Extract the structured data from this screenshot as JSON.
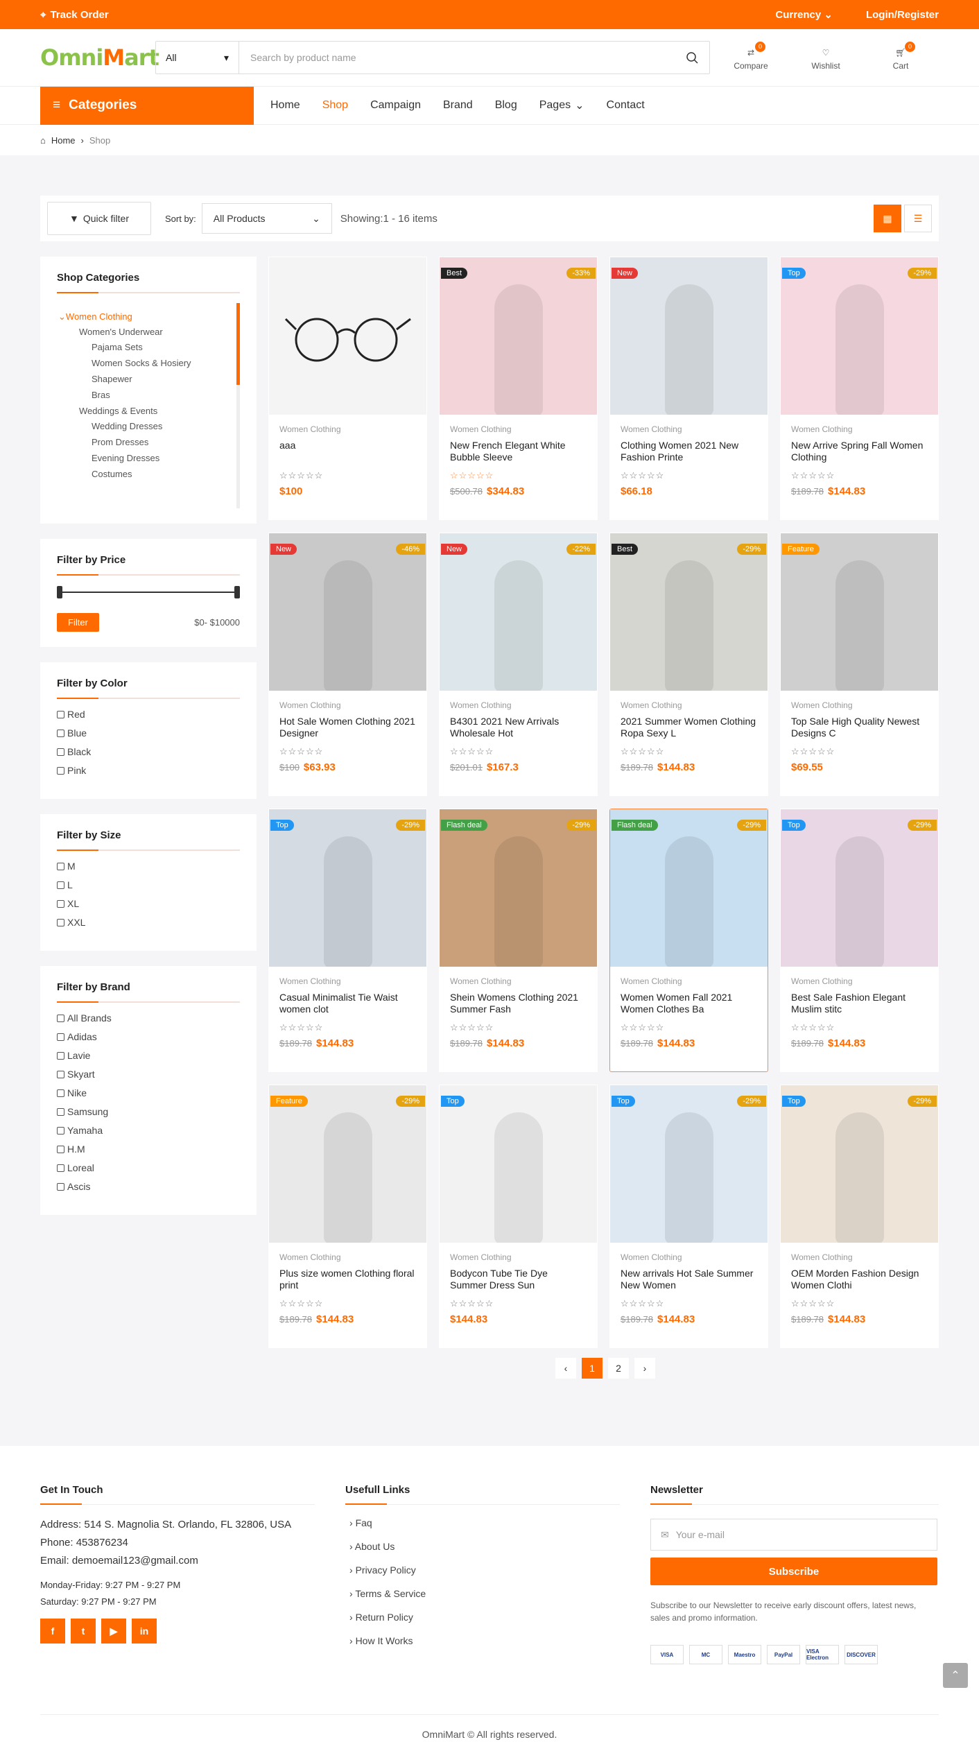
{
  "topbar": {
    "track": "Track Order",
    "currency": "Currency",
    "login": "Login/Register",
    "bg": "#ff6a00"
  },
  "header": {
    "logo_a": "Omni",
    "logo_b": "M",
    "logo_c": "art",
    "category": "All",
    "search_placeholder": "Search by product name",
    "compare": "Compare",
    "compare_count": "0",
    "wishlist": "Wishlist",
    "cart": "Cart",
    "cart_count": "0"
  },
  "nav": {
    "categories": "Categories",
    "items": [
      "Home",
      "Shop",
      "Campaign",
      "Brand",
      "Blog",
      "Pages",
      "Contact"
    ]
  },
  "breadcrumb": {
    "home": "Home",
    "current": "Shop"
  },
  "toolbar": {
    "quick_filter": "Quick filter",
    "sort_label": "Sort by:",
    "sort_value": "All Products",
    "showing": "Showing:1 - 16 items"
  },
  "sidebar": {
    "categories_title": "Shop Categories",
    "tree": [
      "Women Clothing",
      "Women's Underwear",
      "Pajama Sets",
      "Women Socks & Hosiery",
      "Shapewer",
      "Bras",
      "Weddings & Events",
      "Wedding Dresses",
      "Prom Dresses",
      "Evening Dresses",
      "Costumes"
    ],
    "price_title": "Filter by Price",
    "filter_btn": "Filter",
    "price_range": "$0- $10000",
    "color_title": "Filter by Color",
    "colors": [
      "Red",
      "Blue",
      "Black",
      "Pink"
    ],
    "size_title": "Filter by Size",
    "sizes": [
      "M",
      "L",
      "XL",
      "XXL"
    ],
    "brand_title": "Filter by Brand",
    "brands": [
      "All Brands",
      "Adidas",
      "Lavie",
      "Skyart",
      "Nike",
      "Samsung",
      "Yamaha",
      "H.M",
      "Loreal",
      "Ascis"
    ]
  },
  "products": [
    {
      "label": "",
      "discount": "",
      "cat": "Women Clothing",
      "name": "aaa",
      "old": "",
      "price": "$100"
    },
    {
      "label": "Best",
      "discount": "-33%",
      "cat": "Women Clothing",
      "name": "New French Elegant White Bubble Sleeve",
      "old": "$500.78",
      "price": "$344.83"
    },
    {
      "label": "New",
      "discount": "",
      "cat": "Women Clothing",
      "name": "Clothing Women 2021 New Fashion Printe",
      "old": "",
      "price": "$66.18"
    },
    {
      "label": "Top",
      "discount": "-29%",
      "cat": "Women Clothing",
      "name": "New Arrive Spring Fall Women Clothing",
      "old": "$189.78",
      "price": "$144.83"
    },
    {
      "label": "New",
      "discount": "-46%",
      "cat": "Women Clothing",
      "name": "Hot Sale Women Clothing 2021 Designer",
      "old": "$100",
      "price": "$63.93"
    },
    {
      "label": "New",
      "discount": "-22%",
      "cat": "Women Clothing",
      "name": "B4301 2021 New Arrivals Wholesale Hot",
      "old": "$201.01",
      "price": "$167.3"
    },
    {
      "label": "Best",
      "discount": "-29%",
      "cat": "Women Clothing",
      "name": "2021 Summer Women Clothing Ropa Sexy L",
      "old": "$189.78",
      "price": "$144.83"
    },
    {
      "label": "Feature",
      "discount": "",
      "cat": "Women Clothing",
      "name": "Top Sale High Quality Newest Designs C",
      "old": "",
      "price": "$69.55"
    },
    {
      "label": "Top",
      "discount": "-29%",
      "cat": "Women Clothing",
      "name": "Casual Minimalist Tie Waist women clot",
      "old": "$189.78",
      "price": "$144.83"
    },
    {
      "label": "Flash deal",
      "discount": "-29%",
      "cat": "Women Clothing",
      "name": "Shein Womens Clothing 2021 Summer Fash",
      "old": "$189.78",
      "price": "$144.83"
    },
    {
      "label": "Flash deal",
      "discount": "-29%",
      "cat": "Women Clothing",
      "name": "Women Women Fall 2021 Women Clothes Ba",
      "old": "$189.78",
      "price": "$144.83"
    },
    {
      "label": "Top",
      "discount": "-29%",
      "cat": "Women Clothing",
      "name": "Best Sale Fashion Elegant Muslim stitc",
      "old": "$189.78",
      "price": "$144.83"
    },
    {
      "label": "Feature",
      "discount": "-29%",
      "cat": "Women Clothing",
      "name": "Plus size women Clothing floral print",
      "old": "$189.78",
      "price": "$144.83"
    },
    {
      "label": "Top",
      "discount": "",
      "cat": "Women Clothing",
      "name": "Bodycon Tube Tie Dye Summer Dress Sun",
      "old": "",
      "price": "$144.83"
    },
    {
      "label": "Top",
      "discount": "-29%",
      "cat": "Women Clothing",
      "name": "New arrivals Hot Sale Summer New Women",
      "old": "$189.78",
      "price": "$144.83"
    },
    {
      "label": "Top",
      "discount": "-29%",
      "cat": "Women Clothing",
      "name": "OEM Morden Fashion Design Women Clothi",
      "old": "$189.78",
      "price": "$144.83"
    }
  ],
  "stars": "☆☆☆☆☆",
  "pager": {
    "prev": "‹",
    "pages": [
      "1",
      "2"
    ],
    "next": "›"
  },
  "footer": {
    "touch_title": "Get In Touch",
    "address": "Address: 514 S. Magnolia St. Orlando, FL 32806, USA",
    "phone": "Phone: 453876234",
    "email": "Email: demoemail123@gmail.com",
    "hours1": "Monday-Friday: 9:27 PM - 9:27 PM",
    "hours2": "Saturday: 9:27 PM - 9:27 PM",
    "social": [
      "f",
      "t",
      "▶",
      "in"
    ],
    "links_title": "Usefull Links",
    "links": [
      "Faq",
      "About Us",
      "Privacy Policy",
      "Terms & Service",
      "Return Policy",
      "How It Works"
    ],
    "news_title": "Newsletter",
    "news_placeholder": "Your e-mail",
    "subscribe": "Subscribe",
    "news_text": "Subscribe to our Newsletter to receive early discount offers, latest news, sales and promo information.",
    "payments": [
      "VISA",
      "MC",
      "Maestro",
      "PayPal",
      "VISA Electron",
      "DISCOVER"
    ],
    "copyright": "OmniMart © All rights reserved."
  }
}
